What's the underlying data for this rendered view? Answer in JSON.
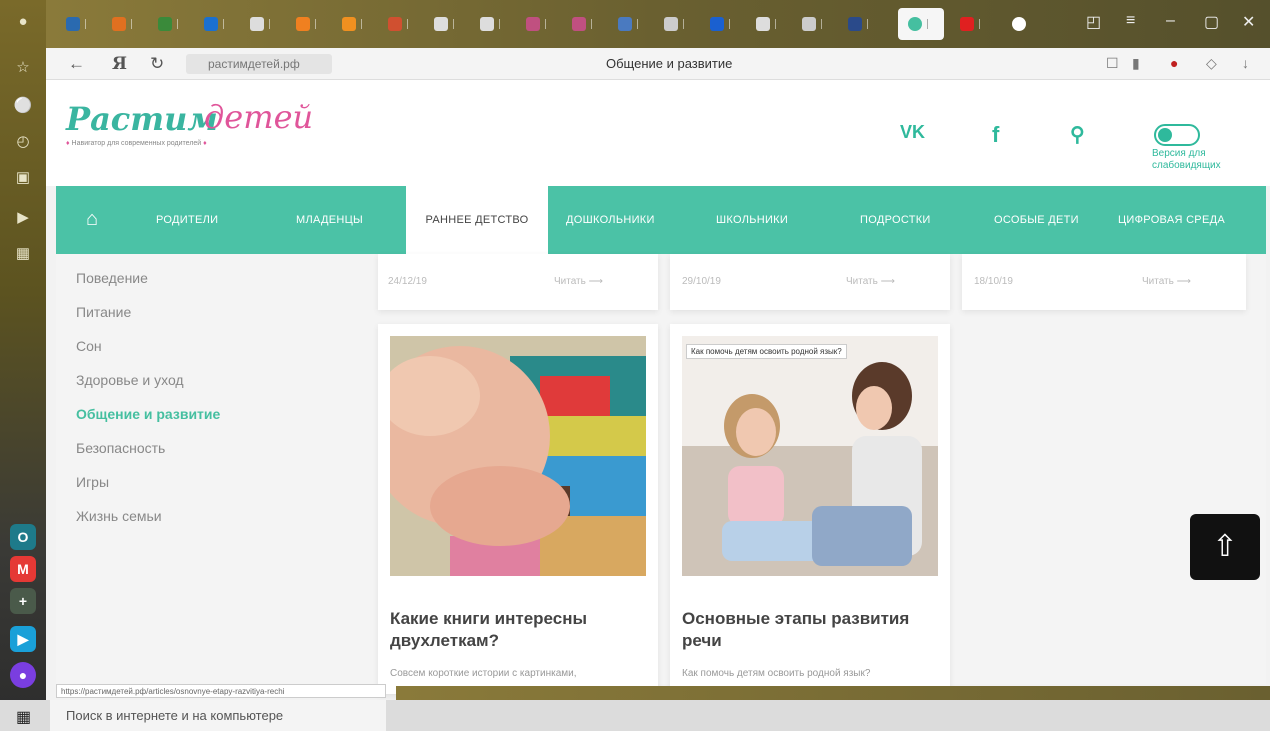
{
  "browser": {
    "url": "растимдетей.рф",
    "page_title": "Общение и развитие",
    "status_url": "https://растимдетей.рф/articles/osnovnye-etapy-razvitiya-rechi"
  },
  "site": {
    "logo_main": "Растим",
    "logo_script": "детей",
    "tagline": "Навигатор для современных родителей",
    "vk": "VK",
    "impaired_label": "Версия для слабовидящих"
  },
  "nav": {
    "items": [
      "РОДИТЕЛИ",
      "МЛАДЕНЦЫ",
      "РАННЕЕ ДЕТСТВО",
      "ДОШКОЛЬНИКИ",
      "ШКОЛЬНИКИ",
      "ПОДРОСТКИ",
      "ОСОБЫЕ ДЕТИ",
      "ЦИФРОВАЯ СРЕДА"
    ],
    "active": "РАННЕЕ ДЕТСТВО"
  },
  "sidebar": {
    "items": [
      "Поведение",
      "Питание",
      "Сон",
      "Здоровье и уход",
      "Общение и развитие",
      "Безопасность",
      "Игры",
      "Жизнь семьи"
    ],
    "active": "Общение и развитие"
  },
  "top_cards": [
    {
      "date": "24/12/19",
      "read": "Читать"
    },
    {
      "date": "29/10/19",
      "read": "Читать"
    },
    {
      "date": "18/10/19",
      "read": "Читать"
    }
  ],
  "cards": [
    {
      "title": "Какие книги интересны двухлеткам?",
      "excerpt": "Совсем короткие истории с картинками,"
    },
    {
      "title": "Основные этапы развития речи",
      "excerpt": "Как помочь детям освоить родной язык?",
      "image_label": "Как помочь детям освоить родной язык?"
    }
  ],
  "taskbar": {
    "search_placeholder": "Поиск в интернете и на компьютере"
  }
}
